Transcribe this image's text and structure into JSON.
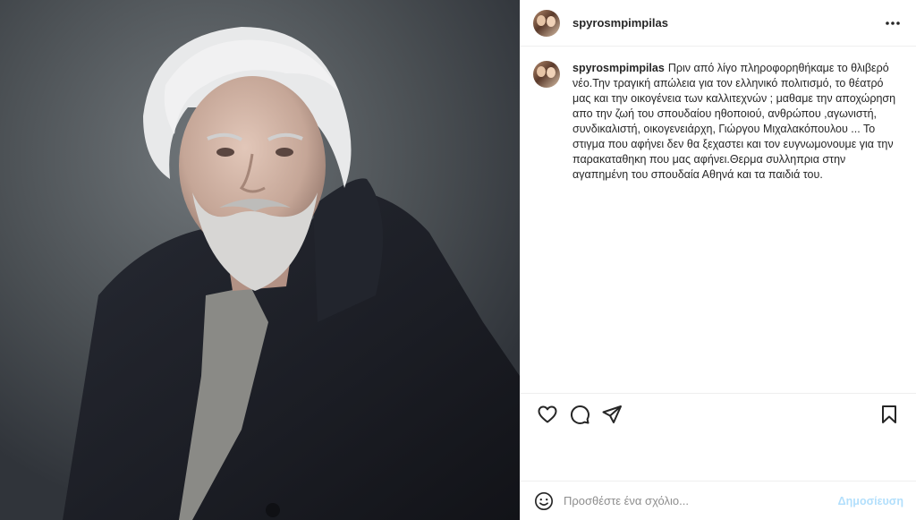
{
  "post": {
    "author": {
      "username": "spyrosmpimpilas"
    },
    "caption": {
      "username": "spyrosmpimpilas",
      "text": "Πριν από λίγο πληροφορηθήκαμε το θλιβερό νέο.Την τραγική απώλεια για τον ελληνικό πολιτισμό, το θέατρό μας και την οικογένεια των καλλιτεχνών ; μαθαμε την αποχώρηση απο την ζωή του σπουδαίου ηθοποιού, ανθρώπου ,αγωνιστή, συνδικαλιστή, οικογενειάρχη, Γιώργου Μιχαλακόπουλου ... Το στιγμα που αφήνει δεν θα ξεχαστει και τον ευγνωμονουμε για την παρακαταθηκη που μας αφήνει.Θερμα συλληπρια στην αγαπημένη του σπουδαία Αθηνά και τα παιδιά του."
    },
    "icons": {
      "more": "more-options-icon",
      "like": "heart-icon",
      "comment": "comment-icon",
      "share": "paper-plane-icon",
      "save": "bookmark-icon",
      "emoji": "emoji-icon"
    },
    "comment_box": {
      "placeholder": "Προσθέστε ένα σχόλιο...",
      "post_label": "Δημοσίευση"
    },
    "colors": {
      "post_button_disabled": "#b2dffc",
      "border": "#efefef",
      "text": "#262626",
      "placeholder": "#8e8e8e"
    }
  }
}
